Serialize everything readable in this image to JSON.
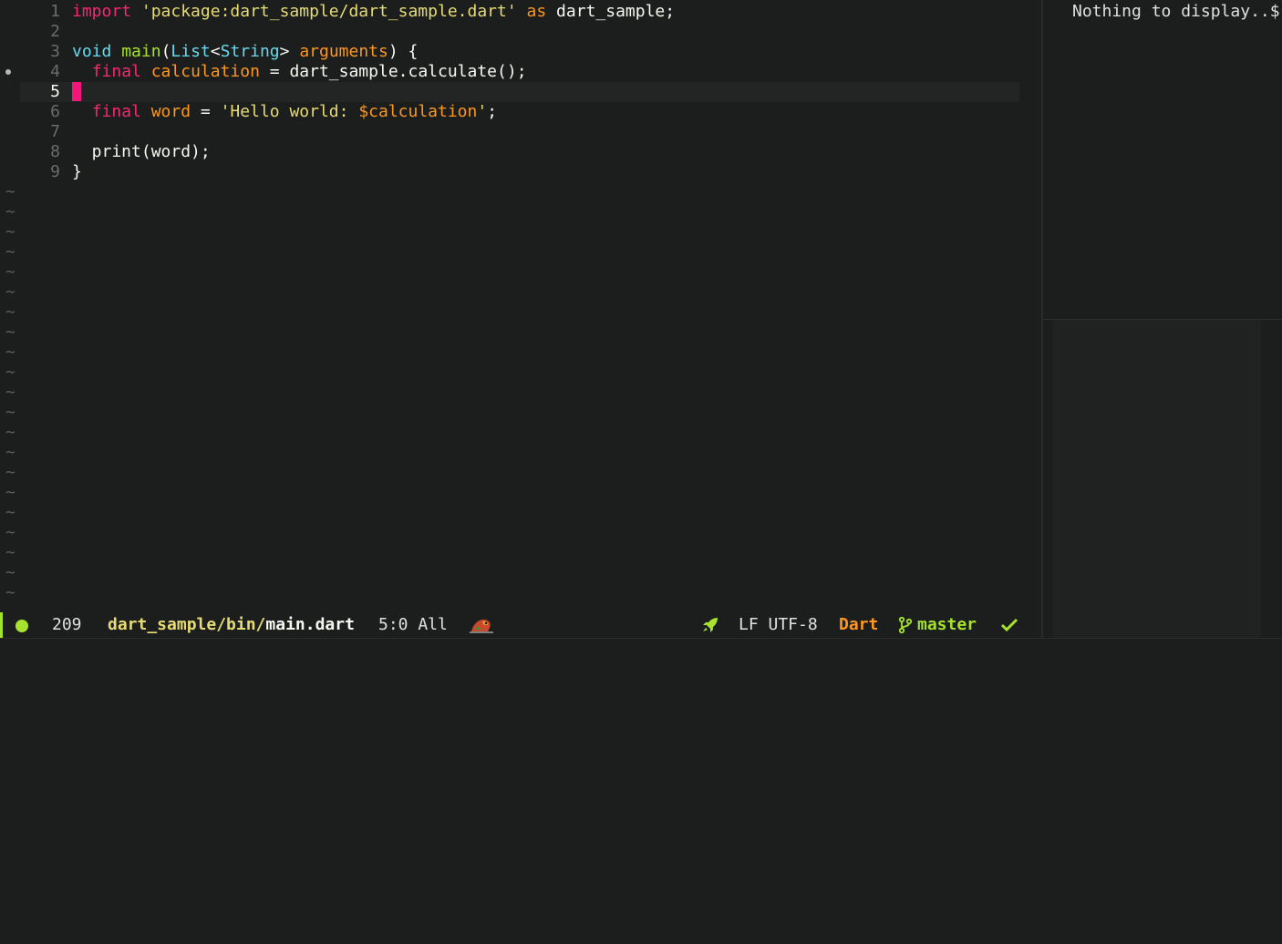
{
  "editor": {
    "lines": [
      {
        "num": "1",
        "segments": [
          [
            "k-import",
            "import"
          ],
          [
            "",
            " "
          ],
          [
            "str",
            "'package:dart_sample/dart_sample.dart'"
          ],
          [
            "",
            " "
          ],
          [
            "k-as",
            "as"
          ],
          [
            "",
            " dart_sample;"
          ]
        ]
      },
      {
        "num": "2",
        "segments": []
      },
      {
        "num": "3",
        "segments": [
          [
            "k-void",
            "void"
          ],
          [
            "",
            " "
          ],
          [
            "fn",
            "main"
          ],
          [
            "",
            "("
          ],
          [
            "type",
            "List"
          ],
          [
            "",
            "<"
          ],
          [
            "type",
            "String"
          ],
          [
            "",
            "> "
          ],
          [
            "param",
            "arguments"
          ],
          [
            "",
            ") {"
          ]
        ]
      },
      {
        "num": "4",
        "segments": [
          [
            "",
            "  "
          ],
          [
            "k-final",
            "final"
          ],
          [
            "",
            " "
          ],
          [
            "var",
            "calculation"
          ],
          [
            "",
            " = dart_sample.calculate();"
          ]
        ]
      },
      {
        "num": "5",
        "segments": []
      },
      {
        "num": "6",
        "segments": [
          [
            "",
            "  "
          ],
          [
            "k-final",
            "final"
          ],
          [
            "",
            " "
          ],
          [
            "var",
            "word"
          ],
          [
            "",
            " = "
          ],
          [
            "str",
            "'Hello world: "
          ],
          [
            "interp",
            "$calculation"
          ],
          [
            "str",
            "'"
          ],
          [
            "",
            ";"
          ]
        ]
      },
      {
        "num": "7",
        "segments": []
      },
      {
        "num": "8",
        "segments": [
          [
            "",
            "  print(word);"
          ]
        ]
      },
      {
        "num": "9",
        "segments": [
          [
            "",
            "}"
          ]
        ]
      }
    ],
    "current_line": "5",
    "empty_line_marker": "~"
  },
  "side_panel": {
    "text": "Nothing to display..$"
  },
  "modeline": {
    "line_count": "209",
    "path_dir": "dart_sample/bin/",
    "path_file": "main.dart",
    "position": "5:0 All",
    "encoding": "LF UTF-8",
    "major_mode": "Dart",
    "branch": "master",
    "icons": [
      "parrot-icon",
      "rocket-icon",
      "git-branch-icon",
      "checkmark-icon"
    ],
    "colors": {
      "accent": "#a6e22e",
      "mode": "#fd971f",
      "dir": "#e6db74"
    }
  }
}
